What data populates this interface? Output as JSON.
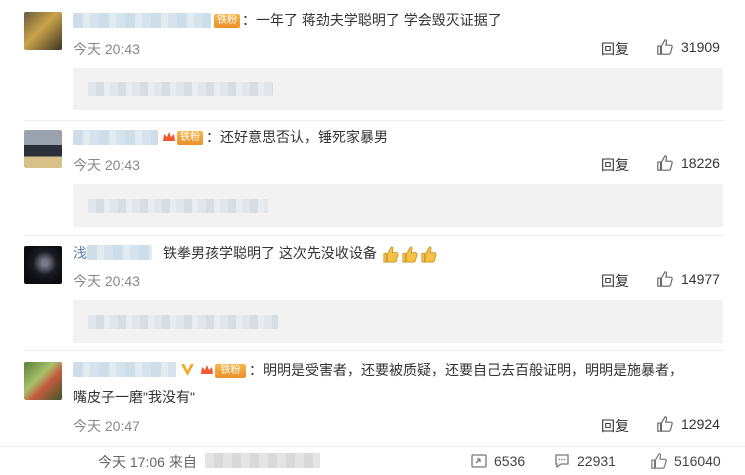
{
  "comments": [
    {
      "text": "：一年了 蒋劲夫学聪明了 学会毁灭证据了",
      "time": "今天 20:43",
      "reply": "回复",
      "likes": "31909",
      "badge": "铁粉"
    },
    {
      "text": "：还好意思否认，锤死家暴男",
      "time": "今天 20:43",
      "reply": "回复",
      "likes": "18226",
      "badge": "铁粉"
    },
    {
      "prefix": "浅",
      "text": "铁拳男孩学聪明了 这次先没收设备",
      "time": "今天 20:43",
      "reply": "回复",
      "likes": "14977"
    },
    {
      "text": "：明明是受害者，还要被质疑，还要自己去百般证明，明明是施暴者，",
      "text2": "嘴皮子一磨\"我没有\"",
      "time": "今天 20:47",
      "reply": "回复",
      "likes": "12924",
      "badge": "铁粉"
    }
  ],
  "footer": {
    "time_prefix": "今天 17:06 来自",
    "reposts": "6536",
    "comments": "22931",
    "likes": "516040"
  },
  "colors": {
    "accent": "#ec8f2a",
    "text": "#333333",
    "meta": "#888888",
    "subbox": "#f2f2f2"
  }
}
